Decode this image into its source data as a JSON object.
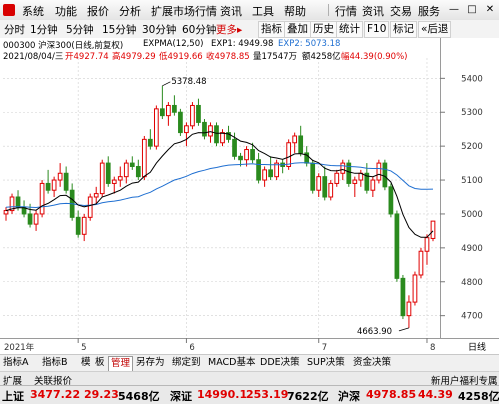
{
  "menu": [
    "系统",
    "功能",
    "报价",
    "分析",
    "扩展市场行情",
    "资讯",
    "工具",
    "帮助"
  ],
  "window_buttons": [
    "行情",
    "资讯",
    "交易",
    "服务"
  ],
  "window_controls": [
    "minimize-icon",
    "restore-icon",
    "close-icon"
  ],
  "toolbar": {
    "periods": [
      "分时",
      "1分钟",
      "5分钟",
      "15分钟",
      "30分钟",
      "60分钟"
    ],
    "more_label": "更多",
    "more_arrow": "▸",
    "actions": [
      "指标",
      "叠加",
      "历史",
      "统计"
    ],
    "f10_label": "F10",
    "mark_label": "标记",
    "back_label": "«后退"
  },
  "chart_info": {
    "title": "000300 沪深300(日线,前复权)",
    "expma_name": "EXPMA(12,50)",
    "exp1": "EXP1: 4949.98",
    "exp2": "EXP2: 5073.18",
    "date": "2021/08/04/三",
    "open": "开4927.74",
    "high": "高4979.29",
    "low": "低4919.66",
    "close": "收4978.85",
    "volume": "量17547万",
    "amount": "额4258亿",
    "change": "幅44.39(0.90%)"
  },
  "price_axis": [
    "5400",
    "5300",
    "5200",
    "5100",
    "5000",
    "4900",
    "4800",
    "4700"
  ],
  "date_axis": {
    "year": "2021年",
    "months": [
      "5",
      "6",
      "7",
      "8"
    ],
    "period_label": "日线"
  },
  "annotations": {
    "high": "5378.48",
    "low": "4663.90"
  },
  "colors": {
    "up": "#e00000",
    "down": "#2a8a1e",
    "exp1": "#000000",
    "exp2": "#1f6fd1",
    "grid": "#cfcfcf"
  },
  "tabs": [
    "指标A",
    "指标B",
    "模",
    "板",
    "管理",
    "另存为",
    "绑定到",
    "MACD基本",
    "DDE决策",
    "SUP决策",
    "资金决策"
  ],
  "active_tab": "管理",
  "subbar": {
    "items": [
      "扩展",
      "关联报价"
    ],
    "right_text": "新用户福利专属"
  },
  "status": {
    "sh_label": "上证",
    "sh_value": "3477.22",
    "sh_change": "29.23",
    "sh_amount": "5468亿",
    "sz_label": "深证",
    "sz_value": "14990.1",
    "sz_change": "253.19",
    "sz_amount": "7622亿",
    "hs_label": "沪深",
    "hs_value": "4978.85",
    "hs_change": "44.39",
    "hs_amount": "4258亿"
  },
  "chart_data": {
    "type": "candlestick",
    "series_names": [
      "EXP1",
      "EXP2"
    ],
    "ylim": [
      4640,
      5460
    ],
    "candles": [
      [
        5000,
        5020,
        4980,
        5010
      ],
      [
        5010,
        5060,
        5000,
        5050
      ],
      [
        5050,
        5070,
        5010,
        5020
      ],
      [
        5020,
        5040,
        4990,
        5000
      ],
      [
        5000,
        5030,
        4960,
        4970
      ],
      [
        4970,
        5010,
        4950,
        5000
      ],
      [
        5000,
        5100,
        4990,
        5090
      ],
      [
        5090,
        5130,
        5060,
        5070
      ],
      [
        5070,
        5110,
        5050,
        5100
      ],
      [
        5100,
        5150,
        5080,
        5120
      ],
      [
        5120,
        5140,
        5060,
        5070
      ],
      [
        5070,
        5090,
        4980,
        4990
      ],
      [
        4990,
        5010,
        4930,
        4940
      ],
      [
        4940,
        5000,
        4920,
        4990
      ],
      [
        4990,
        5060,
        4980,
        5050
      ],
      [
        5050,
        5080,
        5030,
        5060
      ],
      [
        5060,
        5160,
        5050,
        5150
      ],
      [
        5150,
        5170,
        5080,
        5090
      ],
      [
        5090,
        5110,
        5060,
        5100
      ],
      [
        5100,
        5140,
        5080,
        5110
      ],
      [
        5110,
        5160,
        5090,
        5150
      ],
      [
        5150,
        5170,
        5130,
        5140
      ],
      [
        5140,
        5160,
        5100,
        5110
      ],
      [
        5110,
        5230,
        5100,
        5220
      ],
      [
        5220,
        5250,
        5190,
        5200
      ],
      [
        5200,
        5320,
        5190,
        5310
      ],
      [
        5310,
        5378,
        5280,
        5290
      ],
      [
        5290,
        5330,
        5260,
        5320
      ],
      [
        5320,
        5350,
        5290,
        5300
      ],
      [
        5300,
        5310,
        5230,
        5240
      ],
      [
        5240,
        5270,
        5200,
        5260
      ],
      [
        5260,
        5330,
        5250,
        5320
      ],
      [
        5320,
        5340,
        5260,
        5270
      ],
      [
        5270,
        5280,
        5220,
        5230
      ],
      [
        5230,
        5270,
        5210,
        5260
      ],
      [
        5260,
        5270,
        5200,
        5210
      ],
      [
        5210,
        5250,
        5200,
        5240
      ],
      [
        5240,
        5260,
        5210,
        5220
      ],
      [
        5220,
        5240,
        5160,
        5170
      ],
      [
        5170,
        5180,
        5140,
        5160
      ],
      [
        5160,
        5200,
        5140,
        5190
      ],
      [
        5190,
        5210,
        5150,
        5160
      ],
      [
        5160,
        5180,
        5090,
        5100
      ],
      [
        5100,
        5140,
        5080,
        5130
      ],
      [
        5130,
        5170,
        5100,
        5110
      ],
      [
        5110,
        5160,
        5100,
        5150
      ],
      [
        5150,
        5160,
        5120,
        5140
      ],
      [
        5140,
        5220,
        5130,
        5210
      ],
      [
        5210,
        5240,
        5180,
        5230
      ],
      [
        5230,
        5260,
        5170,
        5180
      ],
      [
        5180,
        5200,
        5140,
        5150
      ],
      [
        5150,
        5160,
        5060,
        5070
      ],
      [
        5070,
        5120,
        5050,
        5110
      ],
      [
        5110,
        5140,
        5040,
        5050
      ],
      [
        5050,
        5100,
        5040,
        5090
      ],
      [
        5090,
        5130,
        5080,
        5120
      ],
      [
        5120,
        5160,
        5100,
        5150
      ],
      [
        5150,
        5160,
        5080,
        5090
      ],
      [
        5090,
        5110,
        5050,
        5100
      ],
      [
        5100,
        5130,
        5080,
        5120
      ],
      [
        5120,
        5150,
        5060,
        5070
      ],
      [
        5070,
        5110,
        5050,
        5100
      ],
      [
        5100,
        5160,
        5090,
        5150
      ],
      [
        5150,
        5160,
        5070,
        5080
      ],
      [
        5080,
        5090,
        4990,
        5000
      ],
      [
        5000,
        5010,
        4800,
        4810
      ],
      [
        4810,
        4820,
        4690,
        4700
      ],
      [
        4700,
        4760,
        4663.9,
        4740
      ],
      [
        4740,
        4830,
        4730,
        4820
      ],
      [
        4820,
        4900,
        4810,
        4890
      ],
      [
        4890,
        4940,
        4850,
        4930
      ],
      [
        4927.74,
        4979.29,
        4919.66,
        4978.85
      ]
    ],
    "exp1": [
      5010,
      5015,
      5018,
      5018,
      5013,
      5011,
      5024,
      5031,
      5042,
      5054,
      5055,
      5043,
      5026,
      5021,
      5025,
      5030,
      5050,
      5056,
      5063,
      5070,
      5082,
      5091,
      5094,
      5111,
      5123,
      5150,
      5171,
      5190,
      5207,
      5212,
      5220,
      5235,
      5240,
      5239,
      5243,
      5238,
      5238,
      5236,
      5226,
      5215,
      5211,
      5204,
      5187,
      5178,
      5168,
      5165,
      5161,
      5168,
      5177,
      5178,
      5174,
      5158,
      5151,
      5135,
      5128,
      5127,
      5131,
      5124,
      5120,
      5120,
      5112,
      5110,
      5117,
      5111,
      5094,
      5052,
      4999,
      4960,
      4940,
      4931,
      4931,
      4949.98
    ],
    "exp2": [
      5020,
      5021,
      5021,
      5021,
      5020,
      5019,
      5021,
      5023,
      5026,
      5030,
      5031,
      5030,
      5027,
      5025,
      5026,
      5028,
      5033,
      5036,
      5038,
      5041,
      5045,
      5049,
      5051,
      5058,
      5064,
      5074,
      5082,
      5091,
      5100,
      5105,
      5111,
      5119,
      5125,
      5129,
      5134,
      5137,
      5141,
      5144,
      5145,
      5146,
      5147,
      5148,
      5146,
      5146,
      5145,
      5145,
      5145,
      5147,
      5150,
      5151,
      5151,
      5149,
      5148,
      5145,
      5143,
      5142,
      5142,
      5140,
      5139,
      5138,
      5135,
      5134,
      5134,
      5132,
      5127,
      5115,
      5099,
      5083,
      5075,
      5073,
      5073,
      5073.18
    ]
  }
}
